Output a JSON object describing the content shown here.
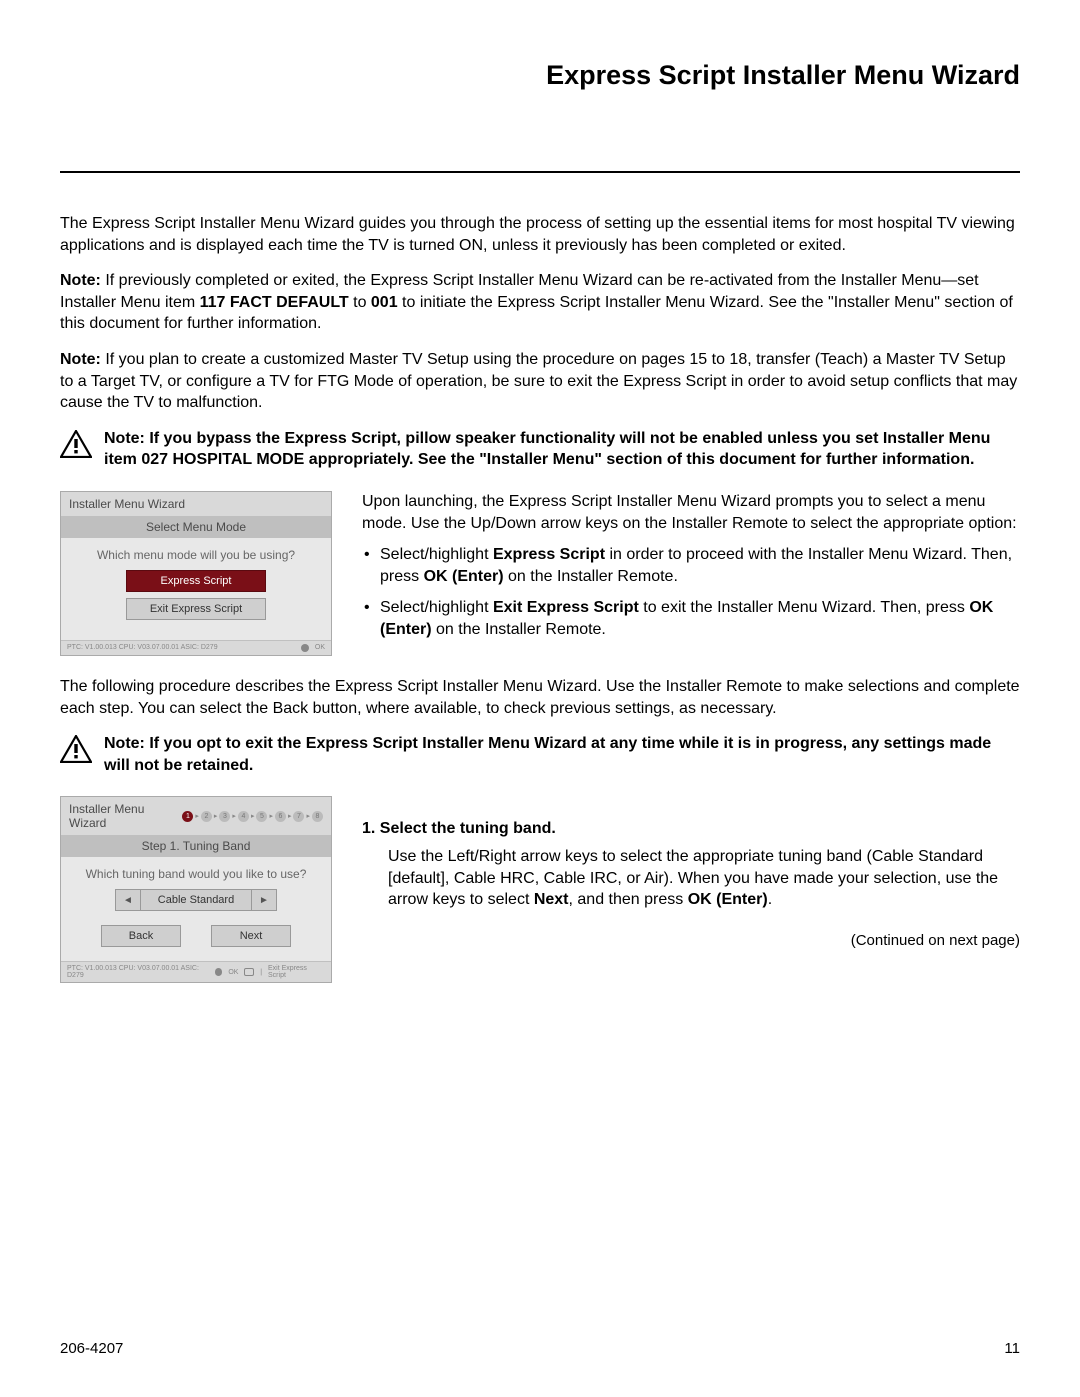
{
  "title": "Express Script Installer Menu Wizard",
  "intro": "The Express Script Installer Menu Wizard guides you through the process of setting up the essential items for most hospital TV viewing applications and is displayed each time the TV is turned ON, unless it previously has been completed or exited.",
  "note1_prefix": "Note:",
  "note1_a": " If previously completed or exited, the Express Script Installer Menu Wizard can be re-activated from the Installer Menu—set Installer Menu item ",
  "note1_bold1": "117 FACT DEFAULT",
  "note1_mid": " to ",
  "note1_bold2": "001",
  "note1_b": " to initiate the Express Script Installer Menu Wizard. See the \"Installer Menu\" section of this document for further information.",
  "note2_prefix": "Note:",
  "note2": " If you plan to create a customized Master TV Setup using the procedure on pages 15 to 18, transfer (Teach) a Master TV Setup to a Target TV, or configure a TV for FTG Mode of operation, be sure to exit the Express Script in order to avoid setup conflicts that may cause the TV to malfunction.",
  "warn1": "Note: If you bypass the Express Script, pillow speaker functionality will not be enabled unless you set Installer Menu item 027 HOSPITAL MODE appropriately. See the \"Installer Menu\" section of this document for further information.",
  "wiz1": {
    "title": "Installer Menu Wizard",
    "sub": "Select Menu Mode",
    "question": "Which menu mode will you be using?",
    "btn_primary": "Express Script",
    "btn_secondary": "Exit Express Script",
    "foot_left": "PTC: V1.00.013 CPU: V03.07.00.01 ASIC: D279",
    "foot_ok": "OK"
  },
  "right1_intro": "Upon launching, the Express Script Installer Menu Wizard prompts you to select a menu mode. Use the Up/Down arrow keys on the Installer Remote to select the appropriate option:",
  "right1_b1_a": "Select/highlight ",
  "right1_b1_bold": "Express Script",
  "right1_b1_b": " in order to proceed with the Installer Menu Wizard. Then, press ",
  "right1_b1_bold2": "OK (Enter)",
  "right1_b1_c": " on the Installer Remote.",
  "right1_b2_a": "Select/highlight ",
  "right1_b2_bold": "Exit Express Script",
  "right1_b2_b": " to exit the Installer Menu Wizard. Then, press ",
  "right1_b2_bold2": "OK (Enter)",
  "right1_b2_c": " on the Installer Remote.",
  "mid_para": "The following procedure describes the Express Script Installer Menu Wizard. Use the Installer Remote to make selections and complete each step. You can select the Back button, where available, to check previous settings, as necessary.",
  "warn2": "Note: If you opt to exit the Express Script Installer Menu Wizard at any time while it is in progress, any settings made will not be retained.",
  "wiz2": {
    "title": "Installer Menu Wizard",
    "sub": "Step 1. Tuning Band",
    "question": "Which tuning band would you like to use?",
    "value": "Cable Standard",
    "back": "Back",
    "next": "Next",
    "foot_left": "PTC: V1.00.013 CPU: V03.07.00.01 ASIC: D279",
    "foot_ok": "OK",
    "foot_exit": "Exit Express Script"
  },
  "step1_num": "1.  ",
  "step1_head": "Select the tuning band.",
  "step1_body_a": "Use the Left/Right arrow keys to select the appropriate tuning band (Cable Standard [default], Cable HRC, Cable IRC, or Air). When you have made your selection, use the arrow keys to select ",
  "step1_bold1": "Next",
  "step1_body_b": ", and then press ",
  "step1_bold2": "OK (Enter)",
  "step1_body_c": ".",
  "continued": "(Continued on next page)",
  "footer_left": "206-4207",
  "footer_right": "11"
}
